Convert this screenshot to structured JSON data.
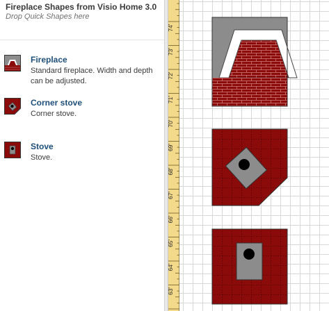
{
  "stencil": {
    "title": "Fireplace Shapes from Visio Home 3.0",
    "hint": "Drop Quick Shapes here",
    "masters": [
      {
        "name": "Fireplace",
        "description": "Standard fireplace.  Width and depth can be adjusted.",
        "icon": "fireplace-icon"
      },
      {
        "name": "Corner stove",
        "description": "Corner stove.",
        "icon": "corner-stove-icon"
      },
      {
        "name": "Stove",
        "description": "Stove.",
        "icon": "stove-icon"
      }
    ]
  },
  "ruler": {
    "labels": [
      "74'",
      "73'",
      "72'",
      "71'",
      "70'",
      "69'",
      "68'",
      "67'",
      "66'",
      "65'",
      "64'",
      "63'"
    ]
  },
  "colors": {
    "brick": "#8b0a0a",
    "mortar": "#d98a8a",
    "firebox": "#8c8c8c",
    "stove_body": "#8c8c8c",
    "ruler_bg": "#f3d98a",
    "grid": "#d7d7d7",
    "link": "#1e4e79"
  }
}
